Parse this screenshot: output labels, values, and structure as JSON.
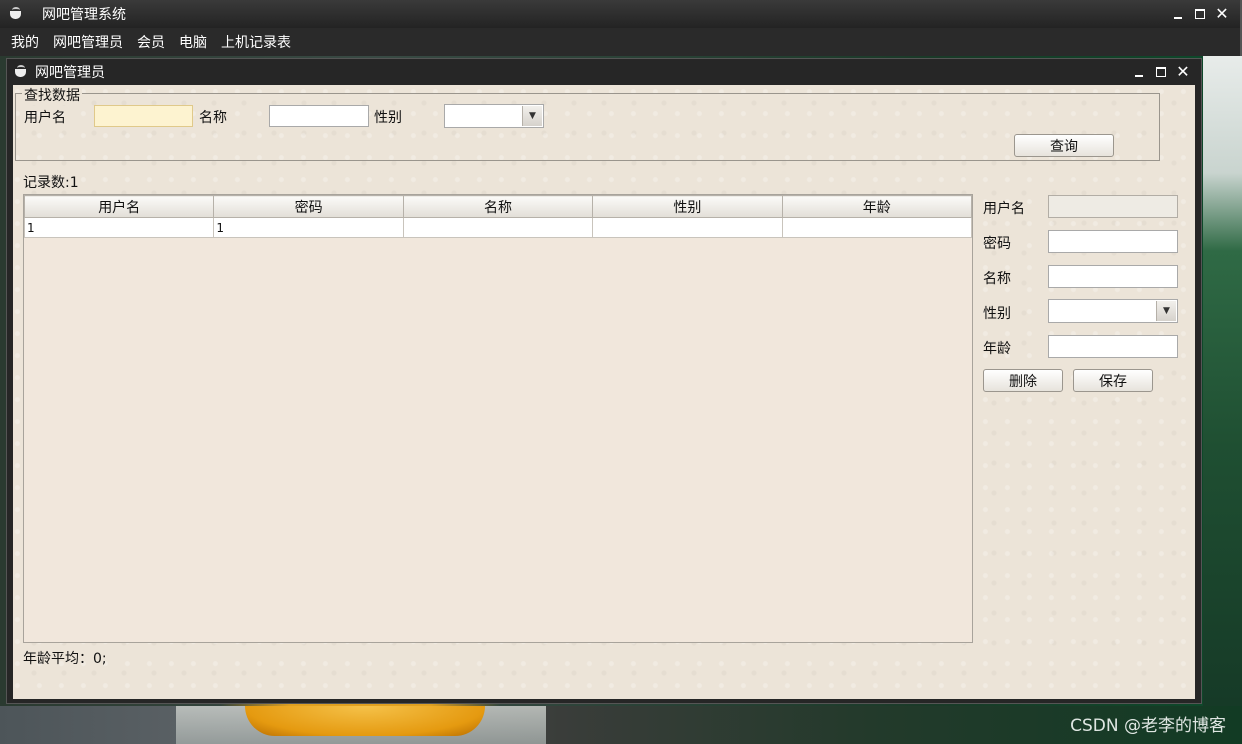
{
  "main_window": {
    "title": "网吧管理系统",
    "menu": [
      "我的",
      "网吧管理员",
      "会员",
      "电脑",
      "上机记录表"
    ]
  },
  "internal_window": {
    "title": "网吧管理员"
  },
  "search": {
    "group_title": "查找数据",
    "username_label": "用户名",
    "username_value": "",
    "name_label": "名称",
    "name_value": "",
    "gender_label": "性别",
    "gender_value": "",
    "query_button": "查询"
  },
  "record_count": "记录数:1",
  "table": {
    "columns": [
      "用户名",
      "密码",
      "名称",
      "性别",
      "年龄"
    ],
    "rows": [
      [
        "1",
        "1",
        "",
        "",
        ""
      ]
    ]
  },
  "average_age": "年龄平均：0;",
  "detail": {
    "username_label": "用户名",
    "username_value": "",
    "password_label": "密码",
    "password_value": "",
    "name_label": "名称",
    "name_value": "",
    "gender_label": "性别",
    "gender_value": "",
    "age_label": "年龄",
    "age_value": "",
    "delete_button": "删除",
    "save_button": "保存"
  },
  "watermark": "CSDN @老李的博客",
  "icons": {
    "app_icon": "coffee-cup-icon",
    "minimize": "minimize-icon",
    "maximize": "maximize-icon",
    "close": "close-icon",
    "dropdown": "chevron-down-icon"
  }
}
